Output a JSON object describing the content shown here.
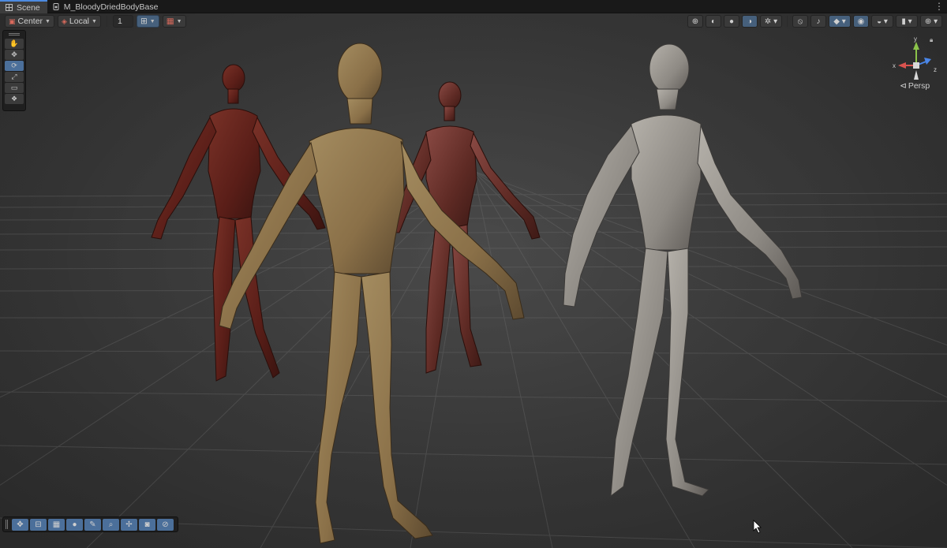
{
  "tabs": [
    {
      "label": "Scene",
      "icon": "scene-grid-icon",
      "active": true
    },
    {
      "label": "M_BloodyDriedBodyBase",
      "icon": "material-icon",
      "active": false
    }
  ],
  "toolbar": {
    "pivot_mode": "Center",
    "pivot_rotation": "Local",
    "increment_value": "1",
    "accent": "#46607c"
  },
  "scene_view": {
    "projection_label": "Persp",
    "gizmo_axes": {
      "x": "x",
      "y": "y",
      "z": "z"
    },
    "axis_colors": {
      "x": "#d9534f",
      "y": "#8bc34a",
      "z": "#4a86e8"
    }
  },
  "tool_palette": [
    "hand-tool",
    "move-tool",
    "rotate-tool",
    "scale-tool",
    "rect-tool",
    "transform-tool"
  ],
  "active_tool": "rotate-tool",
  "bottom_toolbar": [
    "move-tool",
    "scale-tool",
    "grid-tool",
    "sphere-tool",
    "measure-tool",
    "search-tool",
    "pivot-tool",
    "camera-tool",
    "compass-tool"
  ],
  "figures": [
    {
      "name": "bloody-figure-left",
      "skin": "#6a2a22"
    },
    {
      "name": "dried-figure-center",
      "skin": "#9c8458"
    },
    {
      "name": "bloody-figure-right",
      "skin": "#6e3630"
    },
    {
      "name": "pale-figure-right",
      "skin": "#a29e98"
    }
  ]
}
